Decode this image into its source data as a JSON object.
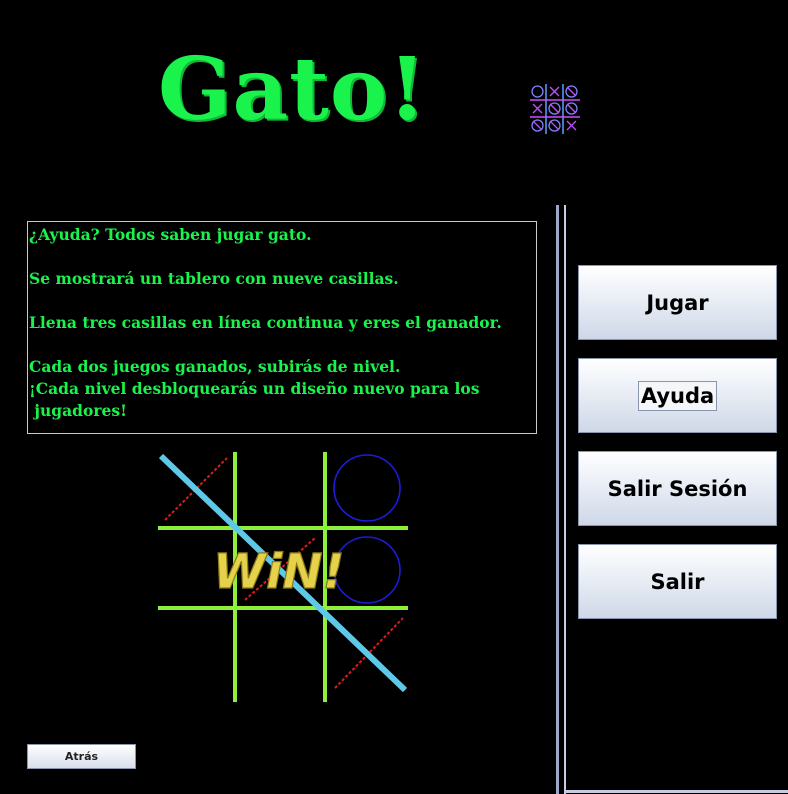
{
  "app": {
    "title": "Gato!"
  },
  "help": {
    "lines": [
      "¿Ayuda? Todos saben jugar gato.",
      "",
      "Se mostrará un tablero con nueve casillas.",
      "",
      "Llena tres casillas en línea continua y eres el ganador.",
      "",
      "Cada dos juegos ganados, subirás de nivel.",
      "¡Cada nivel desbloquearás un diseño nuevo para los",
      " jugadores!"
    ]
  },
  "illustration": {
    "text": "WiN!"
  },
  "menu": {
    "play_label": "Jugar",
    "help_label": "Ayuda",
    "logout_label": "Salir Sesión",
    "exit_label": "Salir"
  },
  "back": {
    "label": "Atrás"
  },
  "colors": {
    "background": "#000000",
    "title_green": "#19f34b",
    "board_lines": "#8ef03a",
    "win_line": "#5ec8e8",
    "circle": "#1c1cd9",
    "cross": "#e11b1b",
    "win_text": "#e6d24a"
  }
}
